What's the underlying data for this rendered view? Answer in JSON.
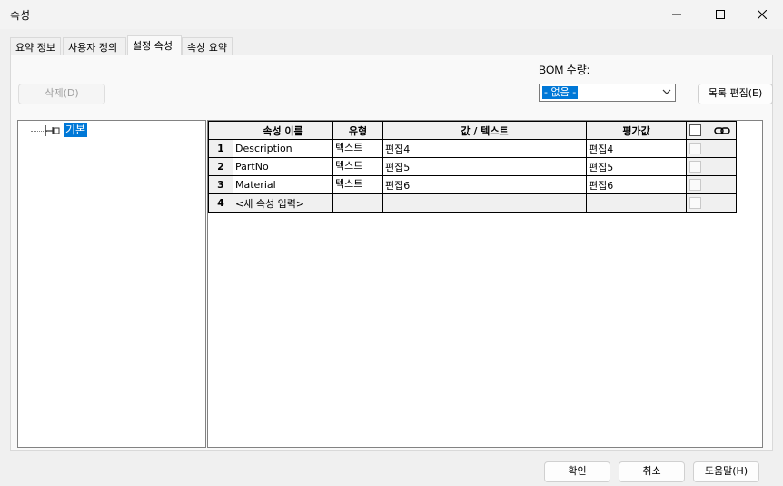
{
  "window": {
    "title": "속성",
    "controls": [
      "minimize-icon",
      "maximize-icon",
      "close-icon"
    ]
  },
  "tabs": [
    {
      "label": "요약 정보"
    },
    {
      "label": "사용자 정의"
    },
    {
      "label": "설정 속성",
      "active": true
    },
    {
      "label": "속성 요약"
    }
  ],
  "toolbar": {
    "delete_label": "삭제(D)",
    "bom_label": "BOM 수량:",
    "bom_value": "- 없음 -",
    "edit_list_label": "목록 편집(E)"
  },
  "tree": {
    "root_label": "기본",
    "icon": "config-node-icon"
  },
  "grid": {
    "columns": [
      "속성 이름",
      "유형",
      "값 / 텍스트",
      "평가값"
    ],
    "rows": [
      {
        "num": "1",
        "name": "Description",
        "type": "텍스트",
        "value": "편집4",
        "evaluated": "편집4"
      },
      {
        "num": "2",
        "name": "PartNo",
        "type": "텍스트",
        "value": "편집5",
        "evaluated": "편집5"
      },
      {
        "num": "3",
        "name": "Material",
        "type": "텍스트",
        "value": "편집6",
        "evaluated": "편집6"
      }
    ],
    "new_row": {
      "num": "4",
      "placeholder": "<새 속성 입력>"
    }
  },
  "footer": {
    "ok_label": "확인",
    "cancel_label": "취소",
    "help_label": "도움말(H)"
  },
  "colors": {
    "selection": "#0078d7",
    "window_bg": "#f0f0f0"
  }
}
